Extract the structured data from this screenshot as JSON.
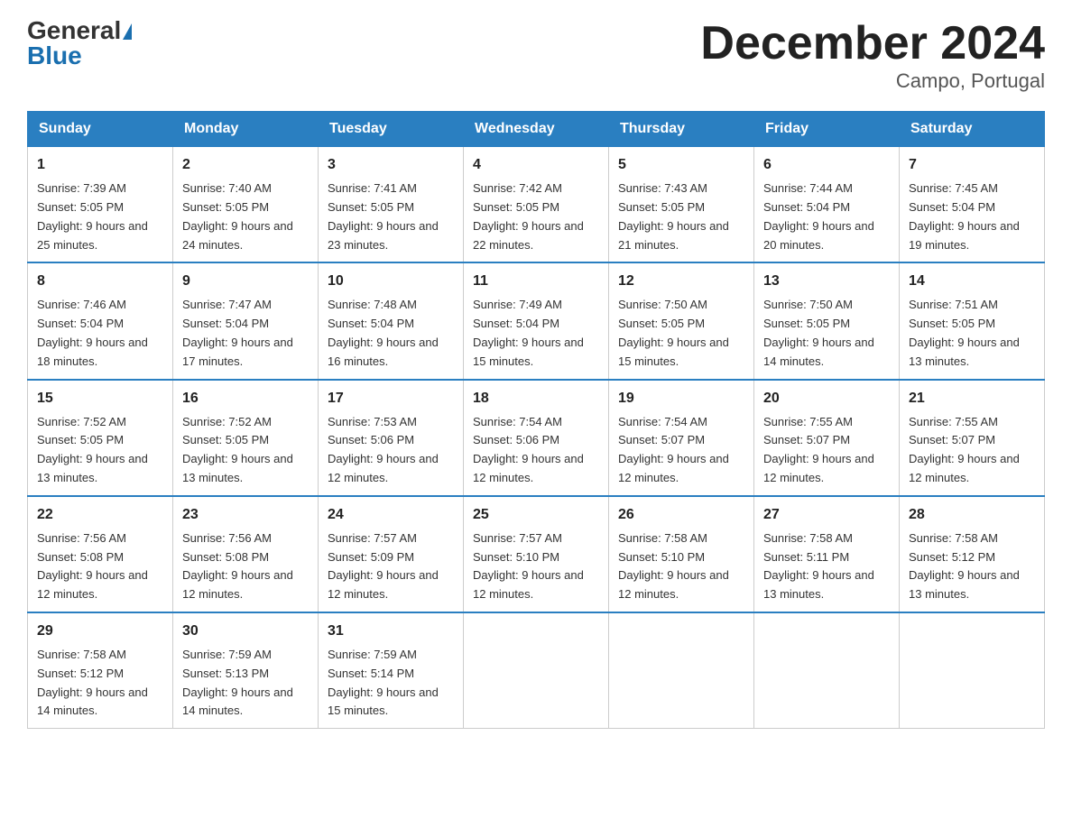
{
  "header": {
    "logo_general": "General",
    "logo_blue": "Blue",
    "title": "December 2024",
    "subtitle": "Campo, Portugal"
  },
  "weekdays": [
    "Sunday",
    "Monday",
    "Tuesday",
    "Wednesday",
    "Thursday",
    "Friday",
    "Saturday"
  ],
  "weeks": [
    [
      {
        "day": "1",
        "sunrise": "7:39 AM",
        "sunset": "5:05 PM",
        "daylight": "9 hours and 25 minutes."
      },
      {
        "day": "2",
        "sunrise": "7:40 AM",
        "sunset": "5:05 PM",
        "daylight": "9 hours and 24 minutes."
      },
      {
        "day": "3",
        "sunrise": "7:41 AM",
        "sunset": "5:05 PM",
        "daylight": "9 hours and 23 minutes."
      },
      {
        "day": "4",
        "sunrise": "7:42 AM",
        "sunset": "5:05 PM",
        "daylight": "9 hours and 22 minutes."
      },
      {
        "day": "5",
        "sunrise": "7:43 AM",
        "sunset": "5:05 PM",
        "daylight": "9 hours and 21 minutes."
      },
      {
        "day": "6",
        "sunrise": "7:44 AM",
        "sunset": "5:04 PM",
        "daylight": "9 hours and 20 minutes."
      },
      {
        "day": "7",
        "sunrise": "7:45 AM",
        "sunset": "5:04 PM",
        "daylight": "9 hours and 19 minutes."
      }
    ],
    [
      {
        "day": "8",
        "sunrise": "7:46 AM",
        "sunset": "5:04 PM",
        "daylight": "9 hours and 18 minutes."
      },
      {
        "day": "9",
        "sunrise": "7:47 AM",
        "sunset": "5:04 PM",
        "daylight": "9 hours and 17 minutes."
      },
      {
        "day": "10",
        "sunrise": "7:48 AM",
        "sunset": "5:04 PM",
        "daylight": "9 hours and 16 minutes."
      },
      {
        "day": "11",
        "sunrise": "7:49 AM",
        "sunset": "5:04 PM",
        "daylight": "9 hours and 15 minutes."
      },
      {
        "day": "12",
        "sunrise": "7:50 AM",
        "sunset": "5:05 PM",
        "daylight": "9 hours and 15 minutes."
      },
      {
        "day": "13",
        "sunrise": "7:50 AM",
        "sunset": "5:05 PM",
        "daylight": "9 hours and 14 minutes."
      },
      {
        "day": "14",
        "sunrise": "7:51 AM",
        "sunset": "5:05 PM",
        "daylight": "9 hours and 13 minutes."
      }
    ],
    [
      {
        "day": "15",
        "sunrise": "7:52 AM",
        "sunset": "5:05 PM",
        "daylight": "9 hours and 13 minutes."
      },
      {
        "day": "16",
        "sunrise": "7:52 AM",
        "sunset": "5:05 PM",
        "daylight": "9 hours and 13 minutes."
      },
      {
        "day": "17",
        "sunrise": "7:53 AM",
        "sunset": "5:06 PM",
        "daylight": "9 hours and 12 minutes."
      },
      {
        "day": "18",
        "sunrise": "7:54 AM",
        "sunset": "5:06 PM",
        "daylight": "9 hours and 12 minutes."
      },
      {
        "day": "19",
        "sunrise": "7:54 AM",
        "sunset": "5:07 PM",
        "daylight": "9 hours and 12 minutes."
      },
      {
        "day": "20",
        "sunrise": "7:55 AM",
        "sunset": "5:07 PM",
        "daylight": "9 hours and 12 minutes."
      },
      {
        "day": "21",
        "sunrise": "7:55 AM",
        "sunset": "5:07 PM",
        "daylight": "9 hours and 12 minutes."
      }
    ],
    [
      {
        "day": "22",
        "sunrise": "7:56 AM",
        "sunset": "5:08 PM",
        "daylight": "9 hours and 12 minutes."
      },
      {
        "day": "23",
        "sunrise": "7:56 AM",
        "sunset": "5:08 PM",
        "daylight": "9 hours and 12 minutes."
      },
      {
        "day": "24",
        "sunrise": "7:57 AM",
        "sunset": "5:09 PM",
        "daylight": "9 hours and 12 minutes."
      },
      {
        "day": "25",
        "sunrise": "7:57 AM",
        "sunset": "5:10 PM",
        "daylight": "9 hours and 12 minutes."
      },
      {
        "day": "26",
        "sunrise": "7:58 AM",
        "sunset": "5:10 PM",
        "daylight": "9 hours and 12 minutes."
      },
      {
        "day": "27",
        "sunrise": "7:58 AM",
        "sunset": "5:11 PM",
        "daylight": "9 hours and 13 minutes."
      },
      {
        "day": "28",
        "sunrise": "7:58 AM",
        "sunset": "5:12 PM",
        "daylight": "9 hours and 13 minutes."
      }
    ],
    [
      {
        "day": "29",
        "sunrise": "7:58 AM",
        "sunset": "5:12 PM",
        "daylight": "9 hours and 14 minutes."
      },
      {
        "day": "30",
        "sunrise": "7:59 AM",
        "sunset": "5:13 PM",
        "daylight": "9 hours and 14 minutes."
      },
      {
        "day": "31",
        "sunrise": "7:59 AM",
        "sunset": "5:14 PM",
        "daylight": "9 hours and 15 minutes."
      },
      null,
      null,
      null,
      null
    ]
  ]
}
